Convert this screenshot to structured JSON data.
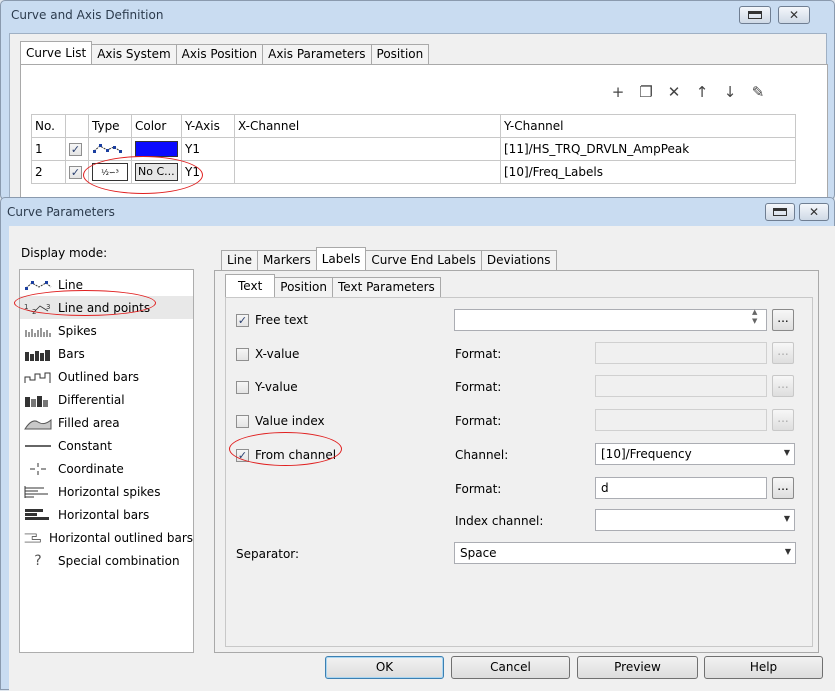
{
  "main_window": {
    "title": "Curve and Axis Definition",
    "tabs": [
      {
        "label": "Curve List"
      },
      {
        "label": "Axis System"
      },
      {
        "label": "Axis Position"
      },
      {
        "label": "Axis Parameters"
      },
      {
        "label": "Position"
      }
    ],
    "toolbar": {
      "icons": [
        "add-icon",
        "copy-icon",
        "delete-icon",
        "move-up-icon",
        "move-down-icon",
        "edit-icon"
      ]
    },
    "table": {
      "headers": [
        "No.",
        "",
        "Type",
        "Color",
        "Y-Axis",
        "X-Channel",
        "Y-Channel"
      ],
      "rows": [
        {
          "no": "1",
          "checked": true,
          "color_label": "",
          "color": "#0a0aff",
          "y_axis": "Y1",
          "x_channel": "",
          "y_channel": "[11]/HS_TRQ_DRVLN_AmpPeak"
        },
        {
          "no": "2",
          "checked": true,
          "color_label": "No C...",
          "color": "#e6e6e6",
          "y_axis": "Y1",
          "x_channel": "",
          "y_channel": "[10]/Freq_Labels"
        }
      ]
    }
  },
  "curve_window": {
    "title": "Curve Parameters",
    "display_mode_label": "Display mode:",
    "modes": [
      {
        "label": "Line",
        "icon": "line-icon"
      },
      {
        "label": "Line and points",
        "icon": "line-and-points-icon",
        "selected": true
      },
      {
        "label": "Spikes",
        "icon": "spikes-icon"
      },
      {
        "label": "Bars",
        "icon": "bars-icon"
      },
      {
        "label": "Outlined bars",
        "icon": "outlined-bars-icon"
      },
      {
        "label": "Differential",
        "icon": "differential-icon"
      },
      {
        "label": "Filled area",
        "icon": "filled-area-icon"
      },
      {
        "label": "Constant",
        "icon": "constant-icon"
      },
      {
        "label": "Coordinate",
        "icon": "coordinate-icon"
      },
      {
        "label": "Horizontal spikes",
        "icon": "horizontal-spikes-icon"
      },
      {
        "label": "Horizontal bars",
        "icon": "horizontal-bars-icon"
      },
      {
        "label": "Horizontal outlined bars",
        "icon": "horizontal-outlined-bars-icon"
      },
      {
        "label": "Special combination",
        "icon": "question-icon"
      }
    ],
    "tabs": [
      {
        "label": "Line"
      },
      {
        "label": "Markers"
      },
      {
        "label": "Labels"
      },
      {
        "label": "Curve End Labels"
      },
      {
        "label": "Deviations"
      }
    ],
    "subtabs": [
      {
        "label": "Text"
      },
      {
        "label": "Position"
      },
      {
        "label": "Text Parameters"
      }
    ],
    "text": {
      "free_text": {
        "label": "Free text",
        "checked": true,
        "value": ""
      },
      "x_value": {
        "label": "X-value",
        "checked": false,
        "format_label": "Format:",
        "format": ""
      },
      "y_value": {
        "label": "Y-value",
        "checked": false,
        "format_label": "Format:",
        "format": ""
      },
      "value_index": {
        "label": "Value index",
        "checked": false,
        "format_label": "Format:",
        "format": ""
      },
      "from_channel": {
        "label": "From channel",
        "checked": true
      },
      "channel": {
        "label": "Channel:",
        "value": "[10]/Frequency"
      },
      "format": {
        "label": "Format:",
        "value": "d"
      },
      "index_channel": {
        "label": "Index channel:",
        "value": ""
      },
      "separator": {
        "label": "Separator:",
        "value": "Space"
      },
      "ellipsis": "..."
    },
    "buttons": {
      "ok": "OK",
      "cancel": "Cancel",
      "preview": "Preview",
      "help": "Help"
    }
  }
}
